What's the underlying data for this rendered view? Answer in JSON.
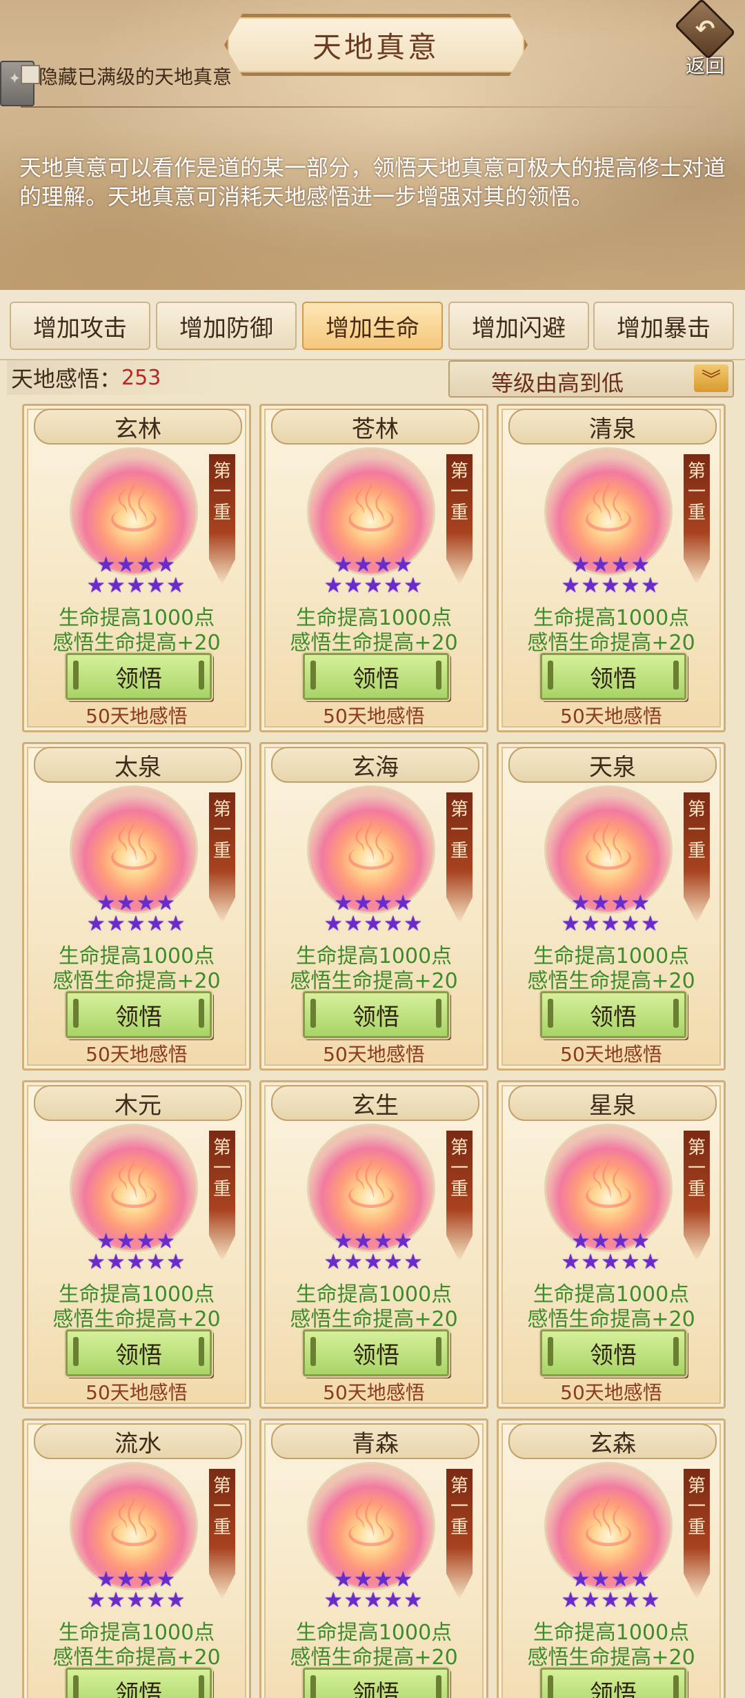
{
  "header": {
    "title": "天地真意",
    "back_label": "返回",
    "hide_maxed_label": "隐藏已满级的天地真意",
    "description": "天地真意可以看作是道的某一部分，领悟天地真意可极大的提高修士对道的理解。天地真意可消耗天地感悟进一步增强对其的领悟。"
  },
  "tabs": [
    {
      "label": "增加攻击",
      "active": false
    },
    {
      "label": "增加防御",
      "active": false
    },
    {
      "label": "增加生命",
      "active": true
    },
    {
      "label": "增加闪避",
      "active": false
    },
    {
      "label": "增加暴击",
      "active": false
    }
  ],
  "points": {
    "label": "天地感悟：",
    "value": "253"
  },
  "sort": {
    "selected": "等级由高到低"
  },
  "card_common": {
    "tier_chars": [
      "第",
      "一",
      "重"
    ],
    "effect_1": "生命提高1000点",
    "effect_2": "感悟生命提高+20",
    "button_label": "领悟",
    "cost": "50天地感悟",
    "stars_filled": 9,
    "stars_total": 9,
    "star_color": "#6a2bc9"
  },
  "cards": [
    {
      "name": "玄林"
    },
    {
      "name": "苍林"
    },
    {
      "name": "清泉"
    },
    {
      "name": "太泉"
    },
    {
      "name": "玄海"
    },
    {
      "name": "天泉"
    },
    {
      "name": "木元"
    },
    {
      "name": "玄生"
    },
    {
      "name": "星泉"
    },
    {
      "name": "流水"
    },
    {
      "name": "青森"
    },
    {
      "name": "玄森"
    }
  ],
  "colors": {
    "effect_text": "#3d8c2a",
    "cost_text": "#8a3b1e",
    "points_value": "#b02b23",
    "active_tab": "#f5c77c",
    "button_green": "#a8d467"
  },
  "icons": {
    "back": "back-arrow-icon",
    "sort": "chevron-down-icon",
    "card_art": "flame-orb-icon",
    "star": "star-icon"
  }
}
